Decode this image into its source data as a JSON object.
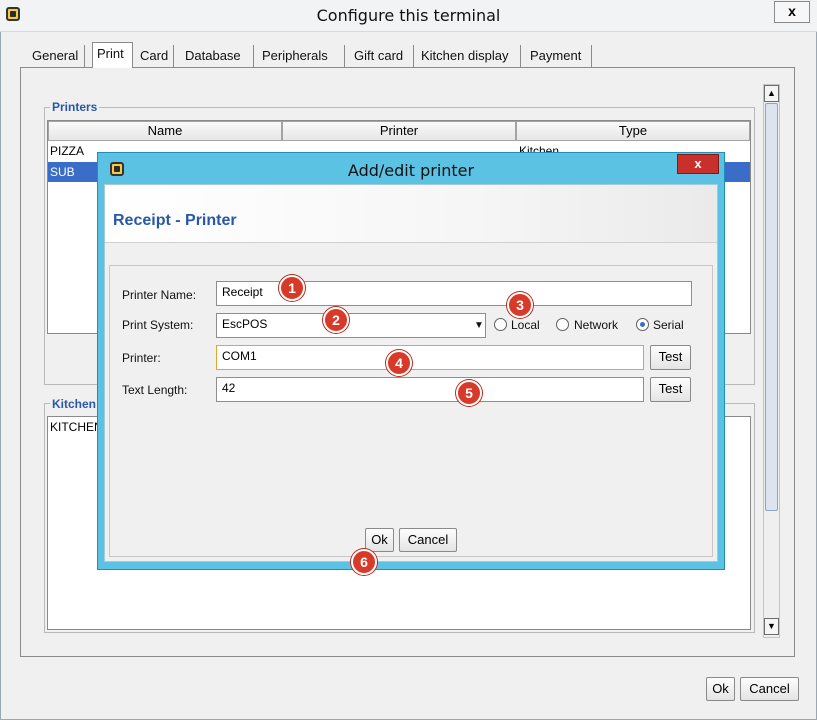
{
  "window": {
    "title": "Configure this terminal",
    "close_label": "x"
  },
  "tabs": [
    {
      "label": "General"
    },
    {
      "label": "Print"
    },
    {
      "label": "Card"
    },
    {
      "label": "Database"
    },
    {
      "label": "Peripherals"
    },
    {
      "label": "Gift card"
    },
    {
      "label": "Kitchen display"
    },
    {
      "label": "Payment"
    }
  ],
  "selected_tab": "Print",
  "printers_group": {
    "title": "Printers",
    "columns": [
      "Name",
      "Printer",
      "Type"
    ],
    "rows": [
      {
        "name": "PIZZA",
        "type": "Kitchen"
      },
      {
        "name": "SUB"
      }
    ]
  },
  "kitchen_group": {
    "title": "Kitchen",
    "rows": [
      {
        "name": "KITCHEN"
      }
    ]
  },
  "footer": {
    "ok_label": "Ok",
    "cancel_label": "Cancel"
  },
  "dialog": {
    "title": "Add/edit printer",
    "close_label": "x",
    "heading": "Receipt - Printer",
    "fields": {
      "printer_name_label": "Printer Name:",
      "printer_name_value": "Receipt",
      "print_system_label": "Print System:",
      "print_system_value": "EscPOS",
      "connection_options": [
        "Local",
        "Network",
        "Serial"
      ],
      "connection_selected": "Serial",
      "printer_label": "Printer:",
      "printer_value": "COM1",
      "text_length_label": "Text Length:",
      "text_length_value": "42",
      "test_label": "Test"
    },
    "ok_label": "Ok",
    "cancel_label": "Cancel"
  },
  "annotations": [
    "1",
    "2",
    "3",
    "4",
    "5",
    "6"
  ],
  "colors": {
    "accent_blue": "#2a58a8",
    "dialog_frame": "#5cc2e4",
    "selected_row": "#3a6dc7",
    "marker_red": "#d83a2a",
    "close_red": "#c9302c"
  }
}
